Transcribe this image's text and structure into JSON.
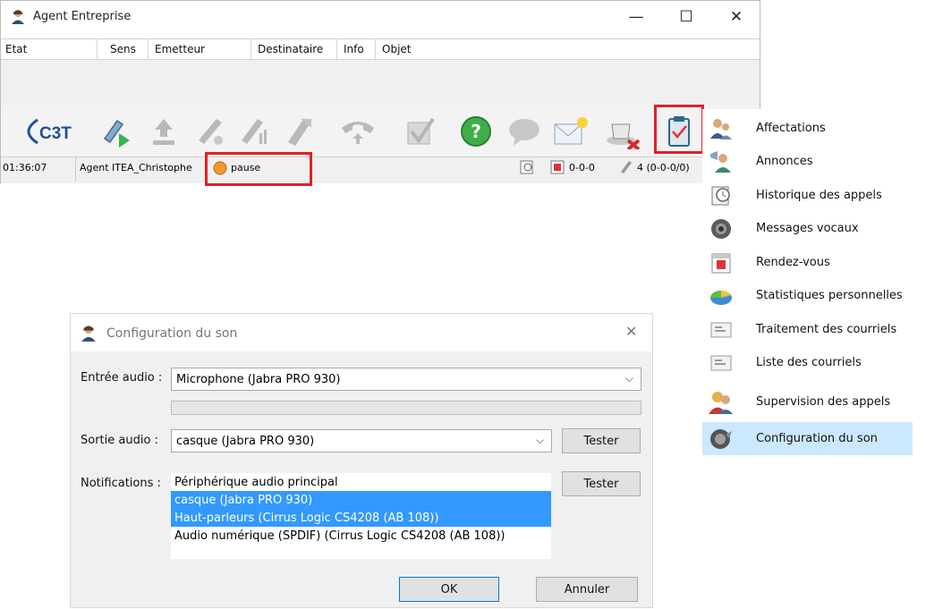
{
  "window": {
    "title": "Agent Entreprise",
    "minimize_glyph": "—",
    "maximize_glyph": "☐",
    "close_glyph": "✕"
  },
  "columns": [
    "Etat",
    "Sens",
    "Emetteur",
    "Destinataire",
    "Info",
    "Objet"
  ],
  "toolbar": {
    "logo": "C3T",
    "icons": [
      "transfer-call-icon",
      "pickup-icon",
      "hangup-icon",
      "conference-icon",
      "forward-icon",
      "hold-icon",
      "validate-icon",
      "help-icon",
      "chat-icon",
      "email-icon",
      "coffee-pause-icon",
      "clipboard-icon"
    ]
  },
  "status": {
    "time": "01:36:07",
    "agent": "Agent ITEA_Christophe",
    "state": "pause",
    "counter": "0-0-0",
    "calls": "4 (0-0-0/0)"
  },
  "menu": {
    "items": [
      {
        "label": "Affectations",
        "icon": "agents-icon"
      },
      {
        "label": "Annonces",
        "icon": "announce-icon"
      },
      {
        "label": "Historique des appels",
        "icon": "history-icon"
      },
      {
        "label": "Messages vocaux",
        "icon": "speaker-icon"
      },
      {
        "label": "Rendez-vous",
        "icon": "calendar-icon"
      },
      {
        "label": "Statistiques personnelles",
        "icon": "stats-icon"
      },
      {
        "label": "Traitement des courriels",
        "icon": "mail-process-icon"
      },
      {
        "label": "Liste des courriels",
        "icon": "mail-list-icon"
      },
      {
        "label": "Supervision des appels",
        "icon": "supervision-icon"
      },
      {
        "label": "Configuration du son",
        "icon": "sound-config-icon"
      }
    ],
    "selected": "Configuration du son"
  },
  "dialog": {
    "title": "Configuration du son",
    "close_glyph": "✕",
    "input_label": "Entrée audio :",
    "input_value": "Microphone (Jabra PRO 930)",
    "output_label": "Sortie audio :",
    "output_value": "casque (Jabra PRO 930)",
    "test_label": "Tester",
    "notifications_label": "Notifications :",
    "notifications_options": [
      "Périphérique audio principal",
      "casque (Jabra PRO 930)",
      "Haut-parleurs (Cirrus Logic CS4208 (AB 108))",
      "Audio numérique (SPDIF) (Cirrus Logic CS4208 (AB 108))"
    ],
    "ok_label": "OK",
    "cancel_label": "Annuler"
  },
  "colors": {
    "highlight_red": "#e0202a",
    "selection_blue": "#3399ff",
    "menu_selected": "#cce8ff"
  }
}
